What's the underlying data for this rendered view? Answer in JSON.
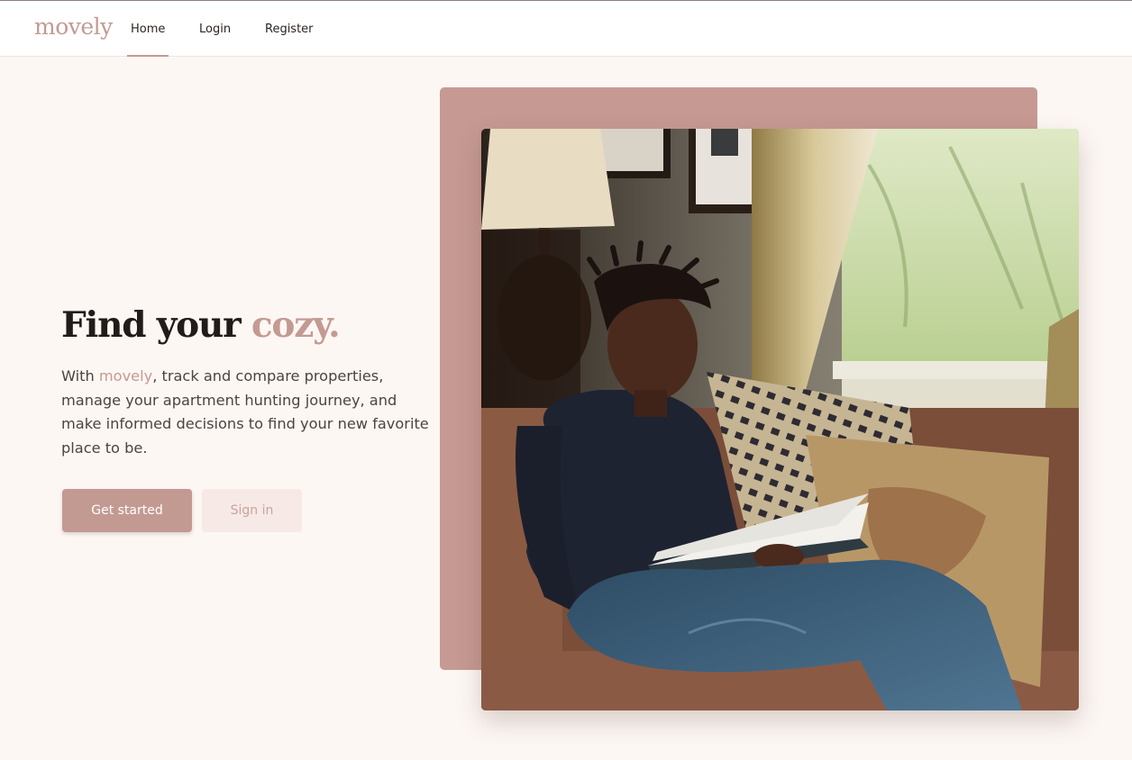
{
  "nav": {
    "logo": "movely",
    "links": [
      {
        "label": "Home",
        "active": true
      },
      {
        "label": "Login"
      },
      {
        "label": "Register"
      }
    ]
  },
  "hero": {
    "headline_prefix": "Find your ",
    "headline_accent": "cozy.",
    "description_prefix": "With ",
    "description_brand": "movely",
    "description_suffix": ", track and compare properties, manage your apartment hunting journey, and make informed decisions to find your new favorite place to be.",
    "primary_button": "Get started",
    "secondary_button": "Sign in"
  },
  "colors": {
    "accent": "#c39a92",
    "background": "#fdf7f4",
    "secondary_button_bg": "#f7e9e6"
  },
  "image": {
    "icon": "hero-photo-woman-reading-on-couch"
  }
}
